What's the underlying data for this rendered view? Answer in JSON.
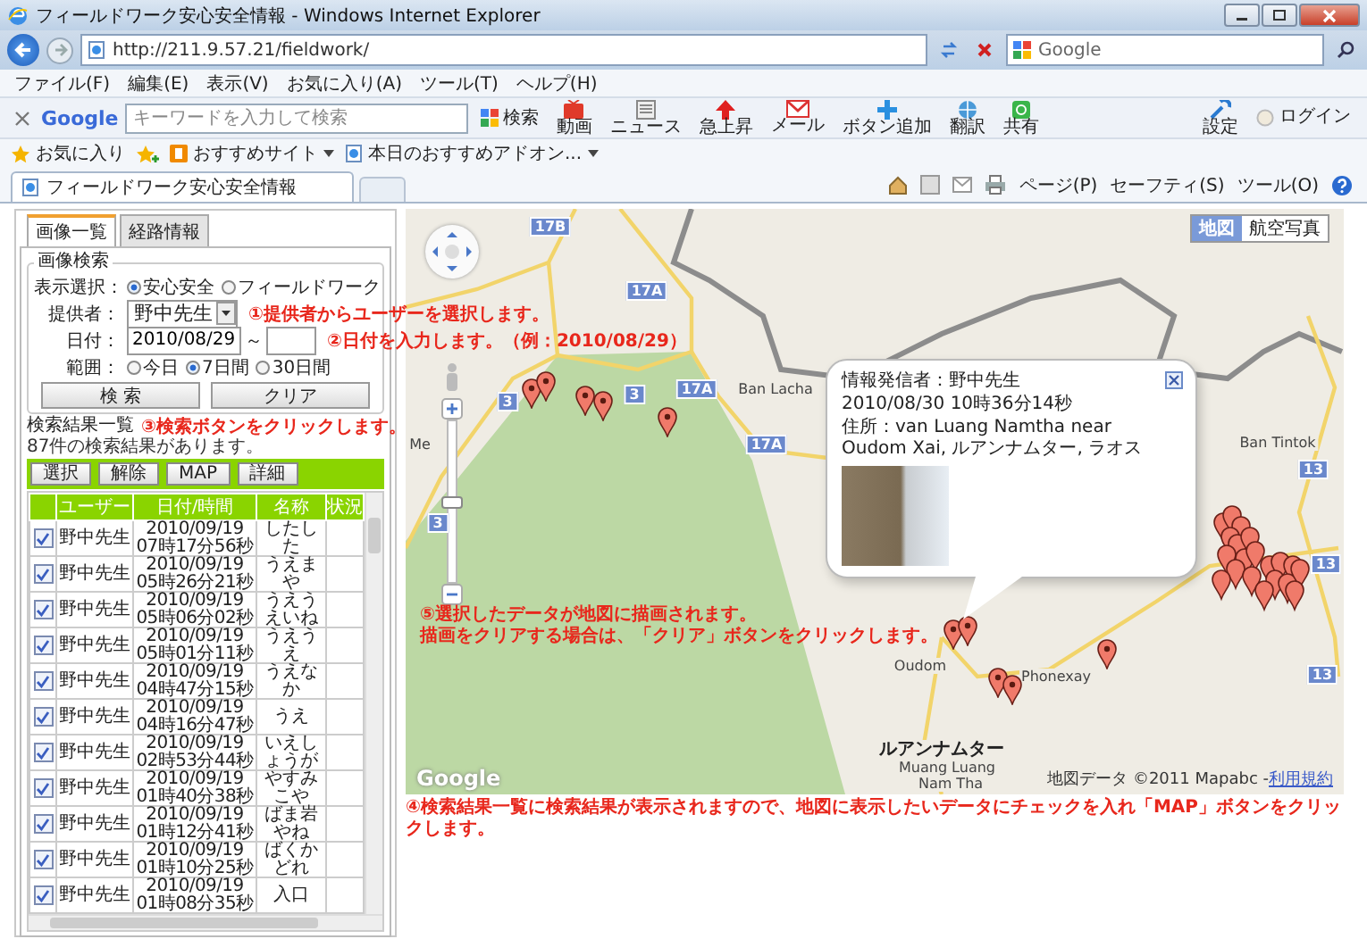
{
  "window": {
    "title": "フィールドワーク安心安全情報 - Windows Internet Explorer"
  },
  "address_bar": {
    "url": "http://211.9.57.21/fieldwork/",
    "search_engine": "Google"
  },
  "menu_bar": [
    "ファイル(F)",
    "編集(E)",
    "表示(V)",
    "お気に入り(A)",
    "ツール(T)",
    "ヘルプ(H)"
  ],
  "google_toolbar": {
    "logo": "Google",
    "placeholder": "キーワードを入力して検索",
    "search_button": "検索",
    "buttons": [
      {
        "label": "動画",
        "kind": "video"
      },
      {
        "label": "ニュース",
        "kind": "news"
      },
      {
        "label": "急上昇",
        "kind": "trend"
      },
      {
        "label": "メール",
        "kind": "mail"
      },
      {
        "label": "ボタン追加",
        "kind": "add"
      },
      {
        "label": "翻訳",
        "kind": "translate"
      },
      {
        "label": "共有",
        "kind": "share"
      }
    ],
    "settings": "設定",
    "login": "ログイン"
  },
  "favorites_bar": {
    "favorites": "お気に入り",
    "links": [
      "おすすめサイト",
      "本日のおすすめアドオン..."
    ]
  },
  "browser_tabs": [
    {
      "label": "フィールドワーク安心安全情報",
      "selected": true
    }
  ],
  "command_bar": [
    "ページ(P)",
    "セーフティ(S)",
    "ツール(O)"
  ],
  "panel": {
    "tabs": [
      {
        "label": "画像一覧",
        "selected": true
      },
      {
        "label": "経路情報",
        "selected": false
      }
    ],
    "search": {
      "legend": "画像検索",
      "display_label": "表示選択：",
      "display_options": [
        {
          "label": "安心安全",
          "selected": true
        },
        {
          "label": "フィールドワーク",
          "selected": false
        }
      ],
      "provider_label": "提供者：",
      "provider": "野中先生",
      "provider_note": "①提供者からユーザーを選択します。",
      "date_label": "日付：",
      "date_from": "2010/08/29",
      "date_separator": "～",
      "date_note": "②日付を入力します。（例：2010/08/29）",
      "range_label": "範囲：",
      "range_options": [
        {
          "label": "今日",
          "selected": false
        },
        {
          "label": "7日間",
          "selected": true
        },
        {
          "label": "30日間",
          "selected": false
        }
      ],
      "buttons": [
        "検 索",
        "クリア"
      ]
    },
    "results": {
      "title": "検索結果一覧",
      "note": "③検索ボタンをクリックします。",
      "count": "87件の検索結果があります。",
      "buttons": [
        "選択",
        "解除",
        "MAP",
        "詳細"
      ],
      "columns": [
        "ユーザー",
        "日付/時間",
        "名称",
        "状況"
      ],
      "rows": [
        {
          "checked": true,
          "user": "野中先生",
          "date": "2010/09/19",
          "time": "07時17分56秒",
          "name": "したした"
        },
        {
          "checked": true,
          "user": "野中先生",
          "date": "2010/09/19",
          "time": "05時26分21秒",
          "name": "うえまや"
        },
        {
          "checked": true,
          "user": "野中先生",
          "date": "2010/09/19",
          "time": "05時06分02秒",
          "name": "うえうえいね"
        },
        {
          "checked": true,
          "user": "野中先生",
          "date": "2010/09/19",
          "time": "05時01分11秒",
          "name": "うえうえ"
        },
        {
          "checked": true,
          "user": "野中先生",
          "date": "2010/09/19",
          "time": "04時47分15秒",
          "name": "うえなか"
        },
        {
          "checked": true,
          "user": "野中先生",
          "date": "2010/09/19",
          "time": "04時16分47秒",
          "name": "うえ"
        },
        {
          "checked": true,
          "user": "野中先生",
          "date": "2010/09/19",
          "time": "02時53分44秒",
          "name": "いえしょうが"
        },
        {
          "checked": true,
          "user": "野中先生",
          "date": "2010/09/19",
          "time": "01時40分38秒",
          "name": "やすみこや"
        },
        {
          "checked": true,
          "user": "野中先生",
          "date": "2010/09/19",
          "time": "01時12分41秒",
          "name": "ばま岩やね"
        },
        {
          "checked": true,
          "user": "野中先生",
          "date": "2010/09/19",
          "time": "01時10分25秒",
          "name": "ばくかどれ"
        },
        {
          "checked": true,
          "user": "野中先生",
          "date": "2010/09/19",
          "time": "01時08分35秒",
          "name": "入口"
        }
      ]
    }
  },
  "map": {
    "zoom_slider": {
      "level": 0.5
    },
    "type_buttons": [
      {
        "label": "地図",
        "selected": true
      },
      {
        "label": "航空写真",
        "selected": false
      }
    ],
    "labels": [
      {
        "text": "17B",
        "kind": "shield"
      },
      {
        "text": "17A",
        "kind": "shield"
      },
      {
        "text": "3",
        "kind": "shield"
      },
      {
        "text": "3",
        "kind": "shield"
      },
      {
        "text": "17A",
        "kind": "shield"
      },
      {
        "text": "Ban Lacha",
        "kind": "place"
      },
      {
        "text": "17A",
        "kind": "shield"
      },
      {
        "text": "3",
        "kind": "shield"
      },
      {
        "text": "Me",
        "kind": "place"
      },
      {
        "text": "Ban Tintok",
        "kind": "place"
      },
      {
        "text": "13",
        "kind": "shield"
      },
      {
        "text": "13",
        "kind": "shield"
      },
      {
        "text": "13",
        "kind": "shield"
      },
      {
        "text": "Oudom",
        "kind": "place"
      },
      {
        "text": "Phonexay",
        "kind": "place"
      },
      {
        "text": "ルアンナムター",
        "kind": "city"
      },
      {
        "text": "Muang Luang",
        "kind": "place"
      },
      {
        "text": "Nam Tha",
        "kind": "place"
      }
    ],
    "popup": {
      "sender": "情報発信者：野中先生",
      "datetime": "2010/08/30 10時36分14秒",
      "address": "住所：van Luang Namtha near Oudom Xai, ルアンナムター, ラオス"
    },
    "notes": [
      "⑤選択したデータが地図に描画されます。",
      "描画をクリアする場合は、「クリア」ボタンをクリックします。"
    ],
    "logo": "Google",
    "copyright": "地図データ ©2011 Mapabc - ",
    "terms": "利用規約"
  },
  "footer_note": "④検索結果一覧に検索結果が表示されますので、地図に表示したいデータにチェックを入れ「MAP」ボタンをクリックします。"
}
